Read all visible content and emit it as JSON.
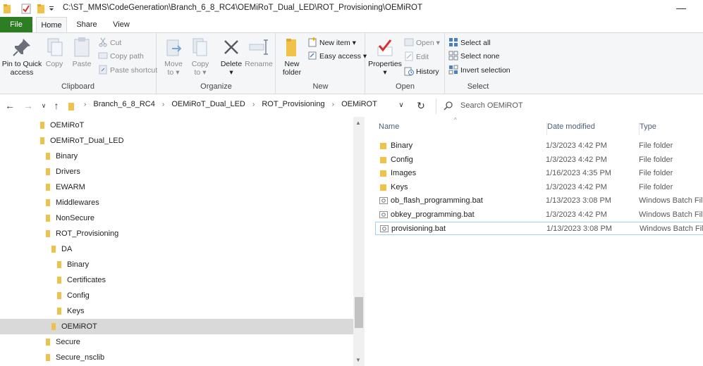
{
  "window": {
    "title": "C:\\ST_MMS\\CodeGeneration\\Branch_6_8_RC4\\OEMiRoT_Dual_LED\\ROT_Provisioning\\OEMiROT",
    "minimize_glyph": "—"
  },
  "quick_access": {
    "icons": [
      "folder-icon",
      "checkmark-icon",
      "folder-icon",
      "dropdown-icon"
    ]
  },
  "tabs": {
    "file": "File",
    "home": "Home",
    "share": "Share",
    "view": "View"
  },
  "ribbon": {
    "clipboard": {
      "label": "Clipboard",
      "pin_line1": "Pin to Quick",
      "pin_line2": "access",
      "copy": "Copy",
      "paste": "Paste",
      "cut": "Cut",
      "copy_path": "Copy path",
      "paste_shortcut": "Paste shortcut"
    },
    "organize": {
      "label": "Organize",
      "move_line1": "Move",
      "move_line2": "to",
      "copy_line1": "Copy",
      "copy_line2": "to",
      "delete": "Delete",
      "rename": "Rename"
    },
    "new": {
      "label": "New",
      "new_folder_line1": "New",
      "new_folder_line2": "folder",
      "new_item": "New item",
      "easy_access": "Easy access"
    },
    "open": {
      "label": "Open",
      "properties": "Properties",
      "open": "Open",
      "edit": "Edit",
      "history": "History"
    },
    "select": {
      "label": "Select",
      "select_all": "Select all",
      "select_none": "Select none",
      "invert_selection": "Invert selection"
    }
  },
  "address": {
    "crumbs": [
      "Branch_6_8_RC4",
      "OEMiRoT_Dual_LED",
      "ROT_Provisioning",
      "OEMiROT"
    ],
    "search_placeholder": "Search OEMiROT"
  },
  "nav_tree": [
    {
      "label": "OEMiRoT",
      "selected": false
    },
    {
      "label": "OEMiRoT_Dual_LED",
      "selected": false
    },
    {
      "label": "Binary",
      "selected": false
    },
    {
      "label": "Drivers",
      "selected": false
    },
    {
      "label": "EWARM",
      "selected": false
    },
    {
      "label": "Middlewares",
      "selected": false
    },
    {
      "label": "NonSecure",
      "selected": false
    },
    {
      "label": "ROT_Provisioning",
      "selected": false
    },
    {
      "label": "DA",
      "selected": false
    },
    {
      "label": "Binary",
      "selected": false
    },
    {
      "label": "Certificates",
      "selected": false
    },
    {
      "label": "Config",
      "selected": false
    },
    {
      "label": "Keys",
      "selected": false
    },
    {
      "label": "OEMiROT",
      "selected": true
    },
    {
      "label": "Secure",
      "selected": false
    },
    {
      "label": "Secure_nsclib",
      "selected": false
    }
  ],
  "columns": {
    "name": "Name",
    "date": "Date modified",
    "type": "Type"
  },
  "files": [
    {
      "name": "Binary",
      "date": "1/3/2023 4:42 PM",
      "type": "File folder",
      "icon": "folder-icon"
    },
    {
      "name": "Config",
      "date": "1/3/2023 4:42 PM",
      "type": "File folder",
      "icon": "folder-icon"
    },
    {
      "name": "Images",
      "date": "1/16/2023 4:35 PM",
      "type": "File folder",
      "icon": "folder-icon"
    },
    {
      "name": "Keys",
      "date": "1/3/2023 4:42 PM",
      "type": "File folder",
      "icon": "folder-icon"
    },
    {
      "name": "ob_flash_programming.bat",
      "date": "1/13/2023 3:08 PM",
      "type": "Windows Batch File",
      "icon": "batch-file-icon"
    },
    {
      "name": "obkey_programming.bat",
      "date": "1/3/2023 4:42 PM",
      "type": "Windows Batch File",
      "icon": "batch-file-icon"
    },
    {
      "name": "provisioning.bat",
      "date": "1/13/2023 3:08 PM",
      "type": "Windows Batch File",
      "icon": "batch-file-icon"
    }
  ],
  "colors": {
    "file_tab": "#2d7d23",
    "folder": "#f0c24a",
    "selection": "#d9d9d9",
    "focus_border": "#99d1ff",
    "header_text": "#4c607a"
  }
}
